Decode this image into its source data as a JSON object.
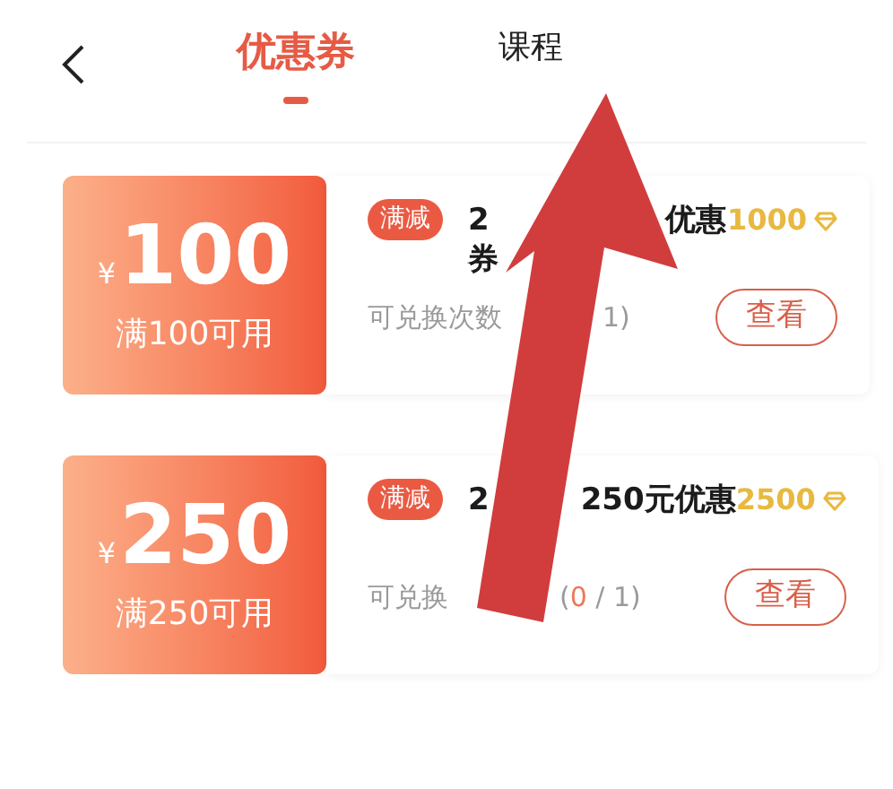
{
  "header": {
    "tabs": [
      {
        "label": "优惠券",
        "selected": true
      },
      {
        "label": "课程",
        "selected": false
      }
    ]
  },
  "coupons": [
    {
      "currency": "¥",
      "amount": "100",
      "condition": "满100可用",
      "tag": "满减",
      "title_parts": [
        "2",
        "优惠"
      ],
      "title_line2": "券",
      "points": "1000",
      "count_parts": [
        {
          "text": "可兑换次数",
          "highlight": false
        },
        {
          "text": "1)",
          "highlight": false
        }
      ],
      "button": "查看"
    },
    {
      "currency": "¥",
      "amount": "250",
      "condition": "满250可用",
      "tag": "满减",
      "title_parts": [
        "2",
        "250元优惠"
      ],
      "points": "2500",
      "count_parts": [
        {
          "text": "可兑换",
          "highlight": false
        },
        {
          "text": "(",
          "highlight": false
        },
        {
          "text": "0",
          "highlight": true
        },
        {
          "text": " / 1)",
          "highlight": false
        }
      ],
      "button": "查看"
    }
  ]
}
